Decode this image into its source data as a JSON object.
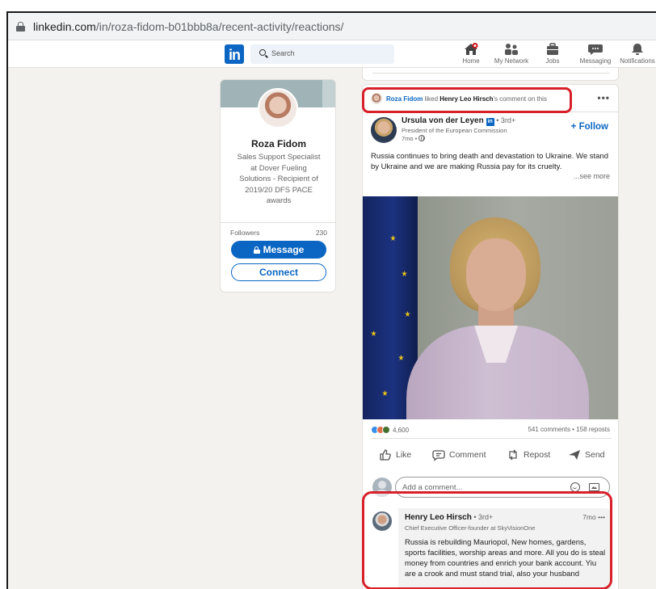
{
  "browser": {
    "url_domain": "linkedin.com",
    "url_path": "/in/roza-fidom-b01bbb8a/recent-activity/reactions/"
  },
  "navbar": {
    "logo_text": "in",
    "search_placeholder": "Search",
    "items": [
      {
        "label": "Home",
        "icon": "home-icon"
      },
      {
        "label": "My Network",
        "icon": "network-icon"
      },
      {
        "label": "Jobs",
        "icon": "briefcase-icon"
      },
      {
        "label": "Messaging",
        "icon": "chat-icon"
      },
      {
        "label": "Notifications",
        "icon": "bell-icon"
      }
    ],
    "notification_dot_color": "#cc1016"
  },
  "profile": {
    "name": "Roza Fidom",
    "headline": "Sales Support Specialist at Dover Fueling Solutions - Recipient of 2019/20 DFS PACE awards",
    "followers_label": "Followers",
    "followers_count": "230",
    "message_button": "Message",
    "connect_button": "Connect"
  },
  "post": {
    "activity": {
      "actor": "Roza Fidom",
      "verb": " liked ",
      "target": "Henry Leo Hirsch",
      "suffix": "'s comment on this"
    },
    "menu_dots": "•••",
    "author": {
      "name": "Ursula von der Leyen",
      "badge": "in",
      "degree": " • 3rd+",
      "headline": "President of the European Commission",
      "time": "7mo •"
    },
    "follow_label": "+ Follow",
    "text": "Russia continues to bring death and devastation to Ukraine. We stand by Ukraine and we are making Russia pay for its cruelty.",
    "see_more": "...see more",
    "reactions_count": "4,600",
    "comments_reposts": "541 comments • 158 reposts",
    "reaction_colors": [
      "#378fe9",
      "#df704d",
      "#44712e"
    ],
    "actions": {
      "like": "Like",
      "comment": "Comment",
      "repost": "Repost",
      "send": "Send"
    },
    "comment_placeholder": "Add a comment..."
  },
  "comment": {
    "name": "Henry Leo Hirsch",
    "degree": " • 3rd+",
    "time": "7mo •••",
    "headline": "Chief Executive Officer-founder at SkyVisionOne",
    "text": "Russia is rebuilding Mauriopol, New homes, gardens, sports facilities, worship areas and more. All you do is steal money from countries and enrich your bank account. Yiu are a crook and must stand trial, also your husband"
  },
  "colors": {
    "linkedin_blue": "#0a66c2",
    "highlight_red": "#d8202a",
    "page_bg": "#f4f2ee"
  }
}
